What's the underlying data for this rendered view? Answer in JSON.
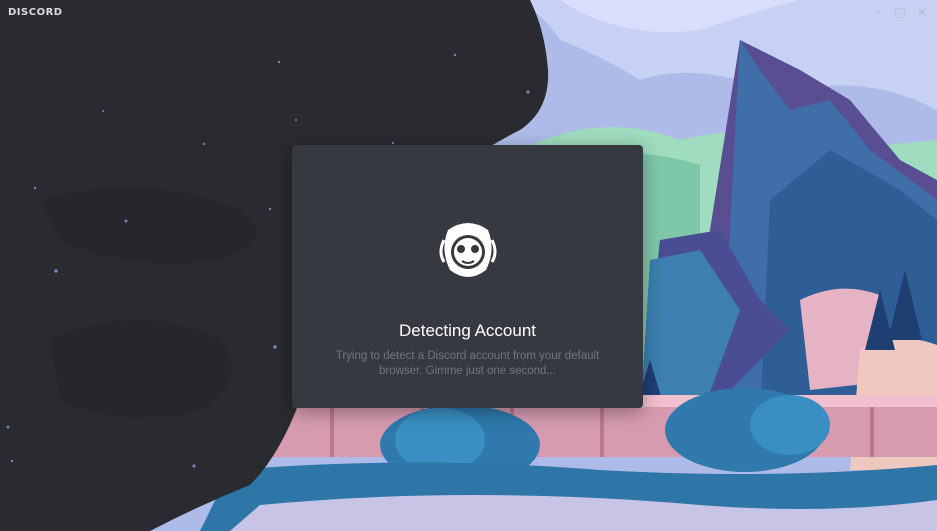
{
  "app": {
    "title": "DISCORD"
  },
  "window_controls": {
    "minimize_glyph": "–",
    "maximize_glyph": "□",
    "close_glyph": "✕"
  },
  "dialog": {
    "icon": "discord-logo-icon",
    "heading": "Detecting Account",
    "message": "Trying to detect a Discord account from your default browser. Gimme just one second..."
  },
  "colors": {
    "dialog_bg": "#36393f",
    "heading": "#ffffff",
    "subtext": "#72767d",
    "dark_panel": "#2a2b30"
  }
}
